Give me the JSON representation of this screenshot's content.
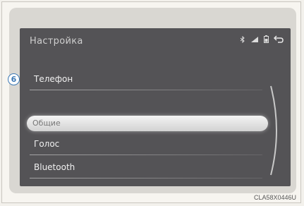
{
  "screen": {
    "title": "Настройка",
    "status_icons": [
      "bluetooth-icon",
      "signal-icon",
      "battery-icon",
      "back-icon"
    ]
  },
  "callout": {
    "number": "6"
  },
  "menu": {
    "items": [
      {
        "label": "Телефон",
        "selected": false
      },
      {
        "label": "Общие",
        "selected": true
      },
      {
        "label": "Голос",
        "selected": false
      },
      {
        "label": "Bluetooth",
        "selected": false
      }
    ]
  },
  "caption": "CLA58X0446U",
  "colors": {
    "screen_bg": "#545356",
    "callout_blue": "#3e7ab6"
  }
}
